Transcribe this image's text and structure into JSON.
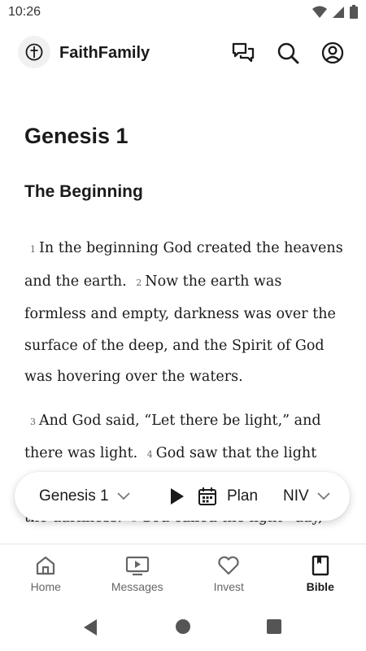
{
  "status_bar": {
    "time": "10:26"
  },
  "app_bar": {
    "title": "FaithFamily",
    "icons": [
      "chat-icon",
      "search-icon",
      "account-icon"
    ]
  },
  "reader": {
    "chapter_title": "Genesis 1",
    "section_title": "The Beginning",
    "paragraphs": [
      [
        {
          "num": "1",
          "text": "In the beginning God created the heavens and the earth."
        },
        {
          "num": "2",
          "text": "Now the earth was formless and empty, darkness was over the surface of the deep, and the Spirit of God was hovering over the waters."
        }
      ],
      [
        {
          "num": "3",
          "text": "And God said, “Let there be light,” and there was light."
        },
        {
          "num": "4",
          "text": "God saw that the light was good, and he separated the light from the darkness."
        },
        {
          "num": "5",
          "text": "God called the light “day,” and the darkness he called “night.” And there"
        }
      ]
    ]
  },
  "player": {
    "book": "Genesis 1",
    "plan_label": "Plan",
    "version": "NIV"
  },
  "bottom_nav": {
    "items": [
      {
        "label": "Home",
        "icon": "home-icon"
      },
      {
        "label": "Messages",
        "icon": "video-icon"
      },
      {
        "label": "Invest",
        "icon": "heart-icon"
      },
      {
        "label": "Bible",
        "icon": "bookmark-book-icon"
      }
    ],
    "active": "Bible"
  },
  "colors": {
    "text": "#1a1a1a",
    "muted": "#666666",
    "background": "#ffffff"
  }
}
